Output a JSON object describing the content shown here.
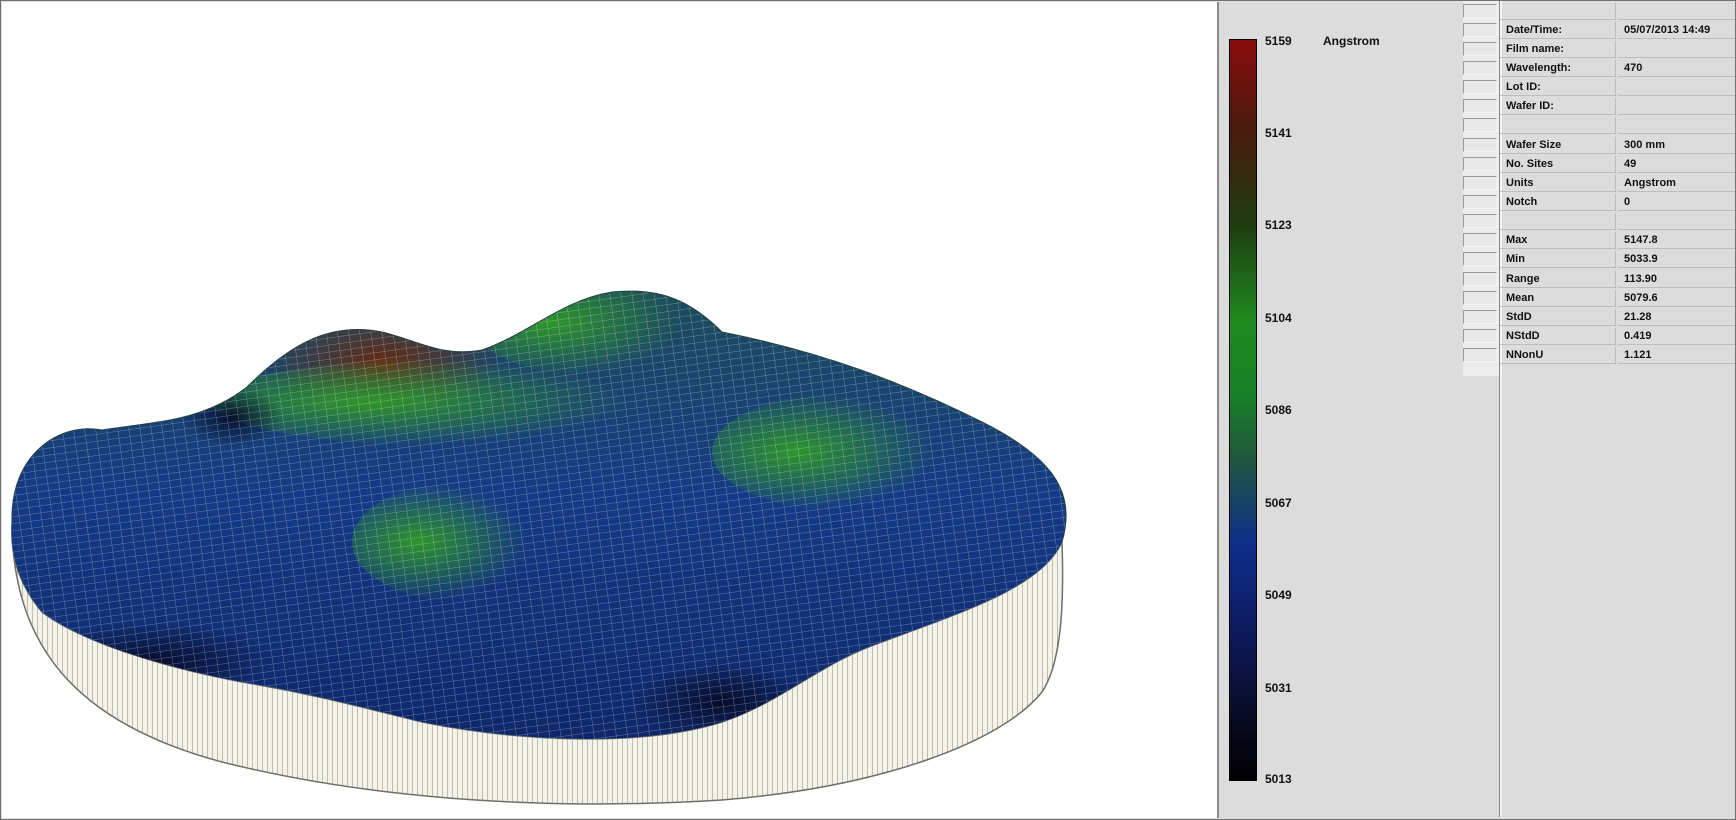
{
  "colorbar": {
    "unit": "Angstrom",
    "ticks": [
      "5159",
      "5141",
      "5123",
      "5104",
      "5086",
      "5067",
      "5049",
      "5031",
      "5013"
    ],
    "colors": [
      "#8a0d0d",
      "#1e8a1e",
      "#0e2f8a",
      "#000000"
    ]
  },
  "params": [
    {
      "label": "",
      "value": ""
    },
    {
      "label": "Date/Time:",
      "value": "05/07/2013 14:49"
    },
    {
      "label": "Film name:",
      "value": ""
    },
    {
      "label": "Wavelength:",
      "value": "470"
    },
    {
      "label": "Lot ID:",
      "value": ""
    },
    {
      "label": "Wafer ID:",
      "value": ""
    },
    {
      "label": "",
      "value": ""
    },
    {
      "label": "Wafer Size",
      "value": "300 mm"
    },
    {
      "label": "No. Sites",
      "value": "49"
    },
    {
      "label": "Units",
      "value": "Angstrom"
    },
    {
      "label": "Notch",
      "value": "0"
    },
    {
      "label": "",
      "value": ""
    },
    {
      "label": "Max",
      "value": "5147.8"
    },
    {
      "label": "Min",
      "value": "5033.9"
    },
    {
      "label": "Range",
      "value": "113.90"
    },
    {
      "label": "Mean",
      "value": "5079.6"
    },
    {
      "label": "StdD",
      "value": "21.28"
    },
    {
      "label": "NStdD",
      "value": "0.419"
    },
    {
      "label": "NNonU",
      "value": "1.121"
    }
  ]
}
